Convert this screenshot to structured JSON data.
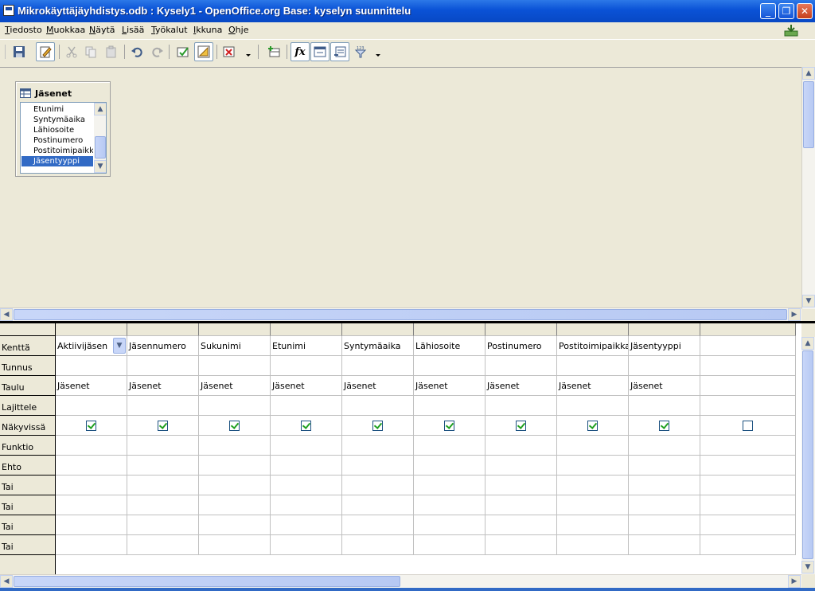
{
  "window": {
    "title": "Mikrokäyttäjäyhdistys.odb : Kysely1 - OpenOffice.org Base: kyselyn suunnittelu",
    "minimize": "_",
    "restore": "❐",
    "close": "✕"
  },
  "menu": {
    "items": [
      "Tiedosto",
      "Muokkaa",
      "Näytä",
      "Lisää",
      "Työkalut",
      "Ikkuna",
      "Ohje"
    ]
  },
  "toolbar": {
    "buttons": [
      "save-icon",
      "edit-mode-icon",
      "cut-icon",
      "copy-icon",
      "paste-icon",
      "undo-icon",
      "redo-icon",
      "run-query-icon",
      "design-view-icon",
      "clear-query-icon",
      "add-table-icon",
      "functions-icon",
      "table-name-icon",
      "alias-icon",
      "distinct-values-icon"
    ],
    "functions_glyph": "fx"
  },
  "table_window": {
    "title": "Jäsenet",
    "fields": [
      "Etunimi",
      "Syntymäaika",
      "Lähiosoite",
      "Postinumero",
      "Postitoimipaikka",
      "Jäsentyyppi"
    ],
    "selected": "Jäsentyyppi"
  },
  "grid": {
    "row_labels": [
      "Kenttä",
      "Tunnus",
      "Taulu",
      "Lajittele",
      "Näkyvissä",
      "Funktio",
      "Ehto",
      "Tai",
      "Tai",
      "Tai",
      "Tai"
    ],
    "columns": [
      {
        "field": "Aktiivijäsen",
        "table": "Jäsenet",
        "visible": true
      },
      {
        "field": "Jäsennumero",
        "table": "Jäsenet",
        "visible": true
      },
      {
        "field": "Sukunimi",
        "table": "Jäsenet",
        "visible": true
      },
      {
        "field": "Etunimi",
        "table": "Jäsenet",
        "visible": true
      },
      {
        "field": "Syntymäaika",
        "table": "Jäsenet",
        "visible": true
      },
      {
        "field": "Lähiosoite",
        "table": "Jäsenet",
        "visible": true
      },
      {
        "field": "Postinumero",
        "table": "Jäsenet",
        "visible": true
      },
      {
        "field": "Postitoimipaikka",
        "table": "Jäsenet",
        "visible": true
      },
      {
        "field": "Jäsentyyppi",
        "table": "Jäsenet",
        "visible": true
      },
      {
        "field": "",
        "table": "",
        "visible": false
      }
    ]
  },
  "colors": {
    "titlebar": "#0a52d6",
    "selection": "#316ac5",
    "checkmark": "#21a121"
  }
}
